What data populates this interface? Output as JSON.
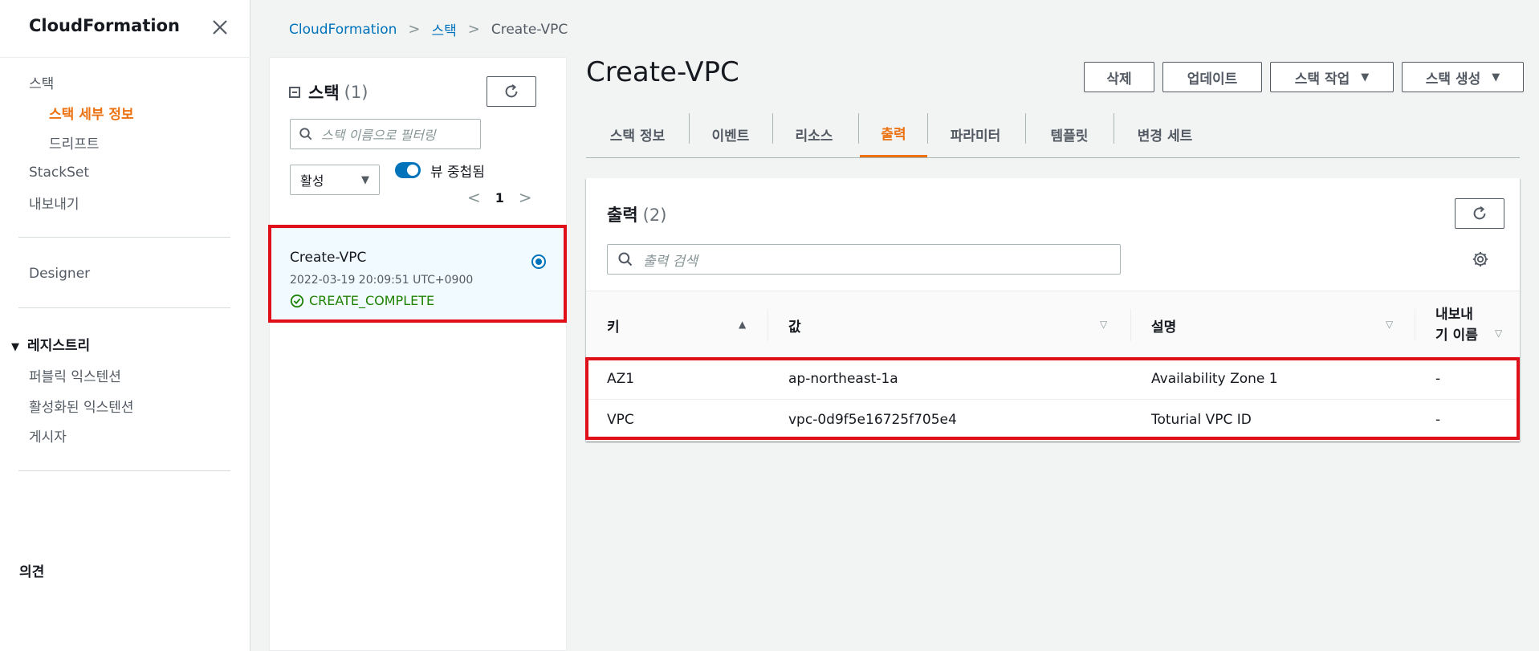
{
  "nav": {
    "title": "CloudFormation",
    "items": [
      {
        "label": "스택"
      },
      {
        "label": "스택 세부 정보",
        "active": true
      },
      {
        "label": "드리프트"
      },
      {
        "label": "StackSet"
      },
      {
        "label": "내보내기"
      },
      {
        "label": "Designer"
      },
      {
        "label": "퍼블릭 익스텐션"
      },
      {
        "label": "활성화된 익스텐션"
      },
      {
        "label": "게시자"
      }
    ],
    "section_registry": "레지스트리",
    "feedback": "의견"
  },
  "breadcrumb": {
    "root": "CloudFormation",
    "stacks": "스택",
    "current": "Create-VPC"
  },
  "stack_panel": {
    "title": "스택",
    "count": "(1)",
    "filter_placeholder": "스택 이름으로 필터링",
    "status_select": "활성",
    "toggle_label": "뷰 중첩됨",
    "page": "1",
    "stack": {
      "name": "Create-VPC",
      "timestamp": "2022-03-19 20:09:51 UTC+0900",
      "status": "CREATE_COMPLETE"
    }
  },
  "main": {
    "title": "Create-VPC",
    "actions": {
      "delete": "삭제",
      "update": "업데이트",
      "stack_actions": "스택 작업",
      "create_stack": "스택 생성"
    },
    "tabs": [
      "스택 정보",
      "이벤트",
      "리소스",
      "출력",
      "파라미터",
      "템플릿",
      "변경 세트"
    ],
    "active_tab": "출력"
  },
  "outputs": {
    "title": "출력",
    "count": "(2)",
    "search_placeholder": "출력 검색",
    "columns": {
      "key": "키",
      "value": "값",
      "description": "설명",
      "export_line1": "내보내",
      "export_line2": "기 이름"
    },
    "rows": [
      {
        "key": "AZ1",
        "value": "ap-northeast-1a",
        "description": "Availability Zone 1",
        "export": "-"
      },
      {
        "key": "VPC",
        "value": "vpc-0d9f5e16725f705e4",
        "description": "Toturial VPC ID",
        "export": "-"
      }
    ]
  },
  "colors": {
    "accent_orange": "#ec7211",
    "link_blue": "#0073bb",
    "success_green": "#1d8102",
    "highlight_red": "#e0101a"
  }
}
